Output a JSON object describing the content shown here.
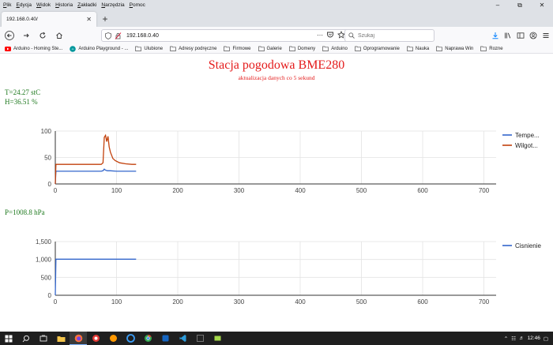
{
  "menubar": {
    "items": [
      {
        "u": "P",
        "rest": "lik"
      },
      {
        "u": "E",
        "rest": "dycja"
      },
      {
        "u": "W",
        "rest": "idok"
      },
      {
        "u": "H",
        "rest": "istoria"
      },
      {
        "u": "Z",
        "rest": "akładki"
      },
      {
        "u": "N",
        "rest": "arzędzia"
      },
      {
        "u": "P",
        "rest": "omoc"
      }
    ]
  },
  "tab": {
    "title": "192.168.0.40/"
  },
  "address": {
    "url": "192.168.0.40"
  },
  "search": {
    "placeholder": "Szukaj"
  },
  "bookmarks": [
    {
      "label": "Arduino - Homing Ste...",
      "icon": "youtube-icon"
    },
    {
      "label": "Arduino Playground - ...",
      "icon": "arduino-icon"
    },
    {
      "label": "Ulubione",
      "icon": "folder-icon"
    },
    {
      "label": "Adresy podręczne",
      "icon": "folder-icon"
    },
    {
      "label": "Firmowe",
      "icon": "folder-icon"
    },
    {
      "label": "Galerie",
      "icon": "folder-icon"
    },
    {
      "label": "Domeny",
      "icon": "folder-icon"
    },
    {
      "label": "Arduino",
      "icon": "folder-icon"
    },
    {
      "label": "Oprogramowanie",
      "icon": "folder-icon"
    },
    {
      "label": "Nauka",
      "icon": "folder-icon"
    },
    {
      "label": "Naprawa Win",
      "icon": "folder-icon"
    },
    {
      "label": "Rozne",
      "icon": "folder-icon"
    }
  ],
  "page": {
    "title": "Stacja pogodowa BME280",
    "subtitle": "aktualizacja danych co 5 sekund",
    "temperature": "T=24.27  stC",
    "humidity": "H=36.51  %",
    "pressure": "P=1008.8  hPa"
  },
  "colors": {
    "title": "#e41b1b",
    "readout": "#1f7a1f",
    "series_blue": "#3366cc",
    "series_red": "#c2410c"
  },
  "chart_data": [
    {
      "type": "line",
      "title": "",
      "xlim": [
        0,
        720
      ],
      "ylim": [
        0,
        100
      ],
      "xticks": [
        "0",
        "100",
        "200",
        "300",
        "400",
        "500",
        "600",
        "700"
      ],
      "yticks": [
        "0",
        "50",
        "100"
      ],
      "grid": true,
      "legend": "right",
      "series": [
        {
          "name": "Tempe...",
          "color": "#3366cc",
          "x": [
            0,
            1,
            75,
            78,
            80,
            82,
            85,
            90,
            100,
            110,
            120,
            132
          ],
          "y": [
            0,
            24,
            24,
            25,
            28,
            26,
            25,
            25,
            24,
            24,
            24,
            24
          ]
        },
        {
          "name": "Wilgot...",
          "color": "#c2410c",
          "x": [
            0,
            1,
            75,
            78,
            80,
            82,
            84,
            86,
            88,
            90,
            94,
            98,
            105,
            115,
            125,
            132
          ],
          "y": [
            0,
            37,
            37,
            40,
            88,
            92,
            80,
            90,
            70,
            60,
            48,
            44,
            40,
            38,
            37,
            37
          ]
        }
      ]
    },
    {
      "type": "line",
      "title": "",
      "xlim": [
        0,
        720
      ],
      "ylim": [
        0,
        1500
      ],
      "xticks": [
        "0",
        "100",
        "200",
        "300",
        "400",
        "500",
        "600",
        "700"
      ],
      "yticks": [
        "0",
        "500",
        "1,000",
        "1,500"
      ],
      "grid": true,
      "legend": "right",
      "series": [
        {
          "name": "Cisnienie",
          "color": "#3366cc",
          "x": [
            0,
            1,
            132
          ],
          "y": [
            0,
            1008,
            1008
          ]
        }
      ]
    }
  ],
  "taskbar": {
    "time": "12:46"
  }
}
